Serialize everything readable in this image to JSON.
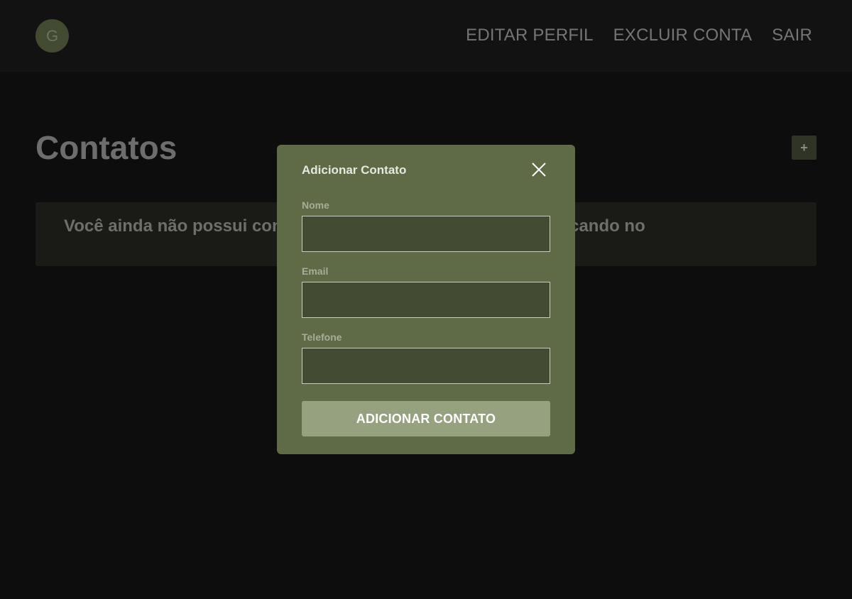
{
  "header": {
    "avatar_letter": "G",
    "nav": [
      {
        "label": "EDITAR PERFIL"
      },
      {
        "label": "EXCLUIR CONTA"
      },
      {
        "label": "SAIR"
      }
    ]
  },
  "main": {
    "title": "Contatos",
    "add_button_icon": "plus-icon",
    "add_button_glyph": "+",
    "empty_message": "Você ainda não possui contatos. Adicione um novo contato clicando no"
  },
  "modal": {
    "title": "Adicionar Contato",
    "close_icon": "close-icon",
    "fields": [
      {
        "label": "Nome",
        "value": ""
      },
      {
        "label": "Email",
        "value": ""
      },
      {
        "label": "Telefone",
        "value": ""
      }
    ],
    "submit_label": "ADICIONAR CONTATO"
  },
  "colors": {
    "background": "#0d0d0d",
    "header": "#121212",
    "modal": "#5f6b46",
    "input": "#434b33",
    "submit": "#96a17f"
  }
}
